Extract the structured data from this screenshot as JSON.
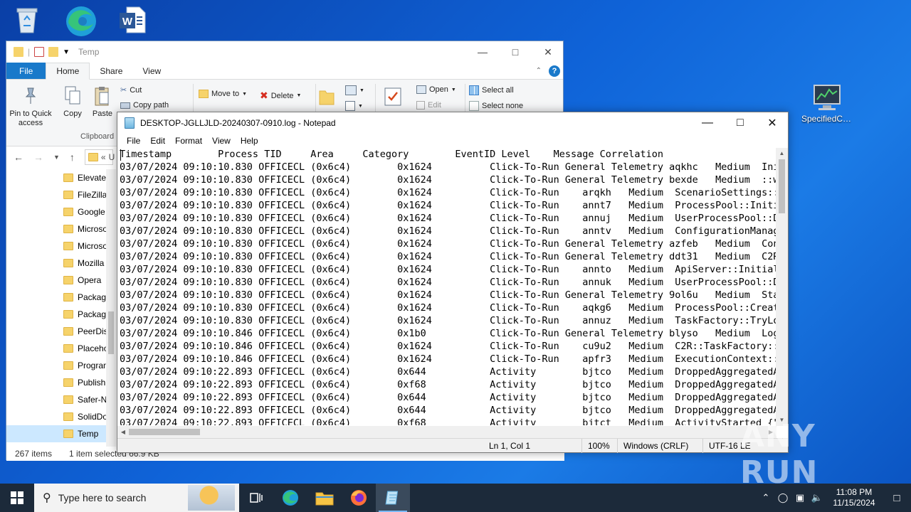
{
  "desktop": {
    "icons": [
      {
        "name": "recycle-bin",
        "label": ""
      },
      {
        "name": "edge",
        "label": ""
      },
      {
        "name": "word",
        "label": ""
      },
      {
        "name": "specified-ca",
        "label": "SpecifiedCa..."
      }
    ]
  },
  "explorer": {
    "title": "Temp",
    "tabs": [
      "File",
      "Home",
      "Share",
      "View"
    ],
    "ribbon": {
      "pin": "Pin to Quick access",
      "copy": "Copy",
      "paste": "Paste",
      "cut": "Cut",
      "copy_path": "Copy path",
      "clipboard_group": "Clipboard",
      "move_to": "Move to",
      "delete": "Delete",
      "open": "Open",
      "edit": "Edit",
      "select_all": "Select all",
      "select_none": "Select none"
    },
    "address_fragment": "U",
    "nav_items": [
      "Elevate",
      "FileZilla",
      "Google",
      "Microso",
      "Microso",
      "Mozilla",
      "Opera",
      "Packag",
      "Packag",
      "PeerDis",
      "Placeho",
      "Progran",
      "Publish",
      "Safer-N",
      "SolidDo",
      "Temp"
    ],
    "status": {
      "items": "267 items",
      "selected": "1 item selected 66.9 KB"
    }
  },
  "notepad": {
    "title": "DESKTOP-JGLLJLD-20240307-0910.log - Notepad",
    "menu": [
      "File",
      "Edit",
      "Format",
      "View",
      "Help"
    ],
    "lines": [
      "Timestamp        Process TID     Area     Category        EventID Level    Message Correlation",
      "03/07/2024 09:10:10.830 OFFICECL (0x6c4)        0x1624          Click-To-Run General Telemetry aqkhc   Medium  Ini",
      "03/07/2024 09:10:10.830 OFFICECL (0x6c4)        0x1624          Click-To-Run General Telemetry bexde   Medium  ::w",
      "03/07/2024 09:10:10.830 OFFICECL (0x6c4)        0x1624          Click-To-Run    arqkh   Medium  ScenarioSettings::F",
      "03/07/2024 09:10:10.830 OFFICECL (0x6c4)        0x1624          Click-To-Run    annt7   Medium  ProcessPool::Initia",
      "03/07/2024 09:10:10.830 OFFICECL (0x6c4)        0x1624          Click-To-Run    annuj   Medium  UserProcessPool::Do",
      "03/07/2024 09:10:10.830 OFFICECL (0x6c4)        0x1624          Click-To-Run    anntv   Medium  ConfigurationManage",
      "03/07/2024 09:10:10.830 OFFICECL (0x6c4)        0x1624          Click-To-Run General Telemetry azfeb   Medium  Con",
      "03/07/2024 09:10:10.830 OFFICECL (0x6c4)        0x1624          Click-To-Run General Telemetry ddt31   Medium  C2R",
      "03/07/2024 09:10:10.830 OFFICECL (0x6c4)        0x1624          Click-To-Run    annto   Medium  ApiServer::Initiali",
      "03/07/2024 09:10:10.830 OFFICECL (0x6c4)        0x1624          Click-To-Run    annuk   Medium  UserProcessPool::Do",
      "03/07/2024 09:10:10.830 OFFICECL (0x6c4)        0x1624          Click-To-Run General Telemetry 9ol6u   Medium  Sta",
      "03/07/2024 09:10:10.830 OFFICECL (0x6c4)        0x1624          Click-To-Run    aqkg6   Medium  ProcessPool::Create",
      "03/07/2024 09:10:10.830 OFFICECL (0x6c4)        0x1624          Click-To-Run    annuz   Medium  TaskFactory::TryLoa",
      "03/07/2024 09:10:10.846 OFFICECL (0x6c4)        0x1b0           Click-To-Run General Telemetry blyso   Medium  Log",
      "03/07/2024 09:10:10.846 OFFICECL (0x6c4)        0x1624          Click-To-Run    cu9u2   Medium  C2R::TaskFactory::T",
      "03/07/2024 09:10:10.846 OFFICECL (0x6c4)        0x1624          Click-To-Run    apfr3   Medium  ExecutionContext::T",
      "03/07/2024 09:10:22.893 OFFICECL (0x6c4)        0x644           Activity        bjtco   Medium  DroppedAggregatedAc",
      "03/07/2024 09:10:22.893 OFFICECL (0x6c4)        0xf68           Activity        bjtco   Medium  DroppedAggregatedAc",
      "03/07/2024 09:10:22.893 OFFICECL (0x6c4)        0x644           Activity        bjtco   Medium  DroppedAggregatedAc",
      "03/07/2024 09:10:22.893 OFFICECL (0x6c4)        0x644           Activity        bjtco   Medium  DroppedAggregatedAc",
      "03/07/2024 09:10:22.893 OFFICECL (0x6c4)        0xf68           Activity        bjtct   Medium  ActivityStarted {\"N"
    ],
    "status": {
      "position": "Ln 1, Col 1",
      "zoom": "100%",
      "line_ending": "Windows (CRLF)",
      "encoding": "UTF-16 LE"
    }
  },
  "taskbar": {
    "search_placeholder": "Type here to search",
    "time": "11:08 PM",
    "date": "11/15/2024"
  },
  "watermark": "ANY RUN"
}
